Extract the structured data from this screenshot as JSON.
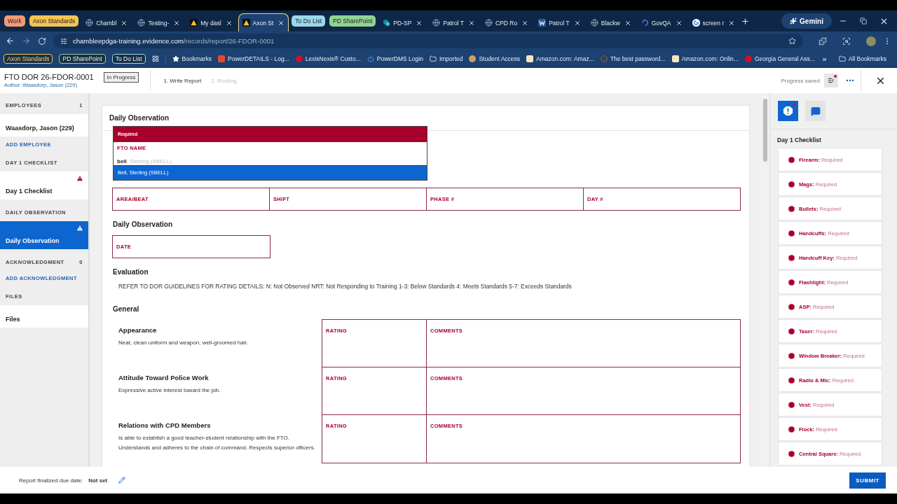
{
  "browser": {
    "tabs": [
      {
        "kind": "group",
        "label": "Work",
        "color": "#f29a76"
      },
      {
        "kind": "group",
        "label": "Axon Standards",
        "color": "#f6c452"
      },
      {
        "kind": "globe",
        "label": "Chambl",
        "selected": false
      },
      {
        "kind": "globe",
        "label": "Testing-",
        "selected": false
      },
      {
        "kind": "axon",
        "label": "My dasl",
        "selected": false
      },
      {
        "kind": "axon",
        "label": "Axon St",
        "selected": true
      },
      {
        "kind": "group",
        "label": "To Do List",
        "color": "#9ad8ea"
      },
      {
        "kind": "group",
        "label": "PD SharePoint",
        "color": "#92d394"
      },
      {
        "kind": "sharepoint",
        "label": "PD-SP",
        "selected": false
      },
      {
        "kind": "globe",
        "label": "Patrol T",
        "selected": false
      },
      {
        "kind": "globe",
        "label": "CPD Ro",
        "selected": false
      },
      {
        "kind": "word",
        "label": "Patrol T",
        "selected": false
      },
      {
        "kind": "globe",
        "label": "Blackw",
        "selected": false
      },
      {
        "kind": "govqa",
        "label": "GovQA",
        "selected": false
      },
      {
        "kind": "google",
        "label": "screen r",
        "selected": false
      }
    ],
    "gemini": "Gemini",
    "address": {
      "host": "chambleepdga-training.evidence.com",
      "path": "/records/report/26-FDOR-0001"
    },
    "bookmark_groups": [
      {
        "label": "Axon Standards",
        "color": "#f6c452"
      },
      {
        "label": "PD SharePoint",
        "color": "#92d394"
      },
      {
        "label": "To Do List",
        "color": "#9ad8ea"
      }
    ],
    "bookmarks": [
      {
        "kind": "star",
        "label": "Bookmarks"
      },
      {
        "kind": "powerdetails",
        "label": "PowerDETAILS - Log..."
      },
      {
        "kind": "lexis",
        "label": "LexisNexis® Custo..."
      },
      {
        "kind": "powerdms",
        "label": "PowerDMS Login"
      },
      {
        "kind": "folder",
        "label": "Imported"
      },
      {
        "kind": "student",
        "label": "Student Access"
      },
      {
        "kind": "amazon",
        "label": "Amazon.com: Amaz..."
      },
      {
        "kind": "info",
        "label": "The best password..."
      },
      {
        "kind": "amazon",
        "label": "Amazon.com: Onlin..."
      },
      {
        "kind": "georgia",
        "label": "Georgia General Ass..."
      }
    ],
    "more": "»",
    "all_bookmarks": "All Bookmarks"
  },
  "header": {
    "title": "FTO DOR 26-FDOR-0001",
    "author": "Author: Waasdorp, Jason (229)",
    "status": "In Progress",
    "steps": [
      {
        "label": "1. Write Report",
        "selected": true
      },
      {
        "label": "2. Routing",
        "selected": false
      }
    ],
    "saved": "Progress saved"
  },
  "sidebar": [
    {
      "heading": "EMPLOYEES",
      "count": "1",
      "items": [
        {
          "label": "Waasdorp, Jason (229)",
          "selected": false,
          "warning": false
        }
      ],
      "link": "ADD EMPLOYEE"
    },
    {
      "heading": "DAY 1 CHECKLIST",
      "items": [
        {
          "label": "Day 1 Checklist",
          "selected": false,
          "warning": true
        }
      ]
    },
    {
      "heading": "DAILY OBSERVATION",
      "items": [
        {
          "label": "Daily Observation",
          "selected": true,
          "warning": true
        }
      ]
    },
    {
      "heading": "ACKNOWLEDGMENT",
      "count": "0",
      "link": "ADD ACKNOWLEDGMENT"
    },
    {
      "heading": "FILES",
      "items": [
        {
          "label": "Files",
          "selected": false,
          "warning": false
        }
      ]
    }
  ],
  "form": {
    "title": "Daily Observation",
    "fto": {
      "banner": "Required",
      "label": "FTO NAME",
      "value": "bell",
      "hint": ", Sterling (SBELL)",
      "options": [
        {
          "label": "Bell, Sterling (SBELL)",
          "selected": true
        }
      ]
    },
    "fields": [
      "AREA/BEAT",
      "SHIFT",
      "PHASE #",
      "DAY #"
    ],
    "sections": [
      {
        "kind": "fields",
        "title": "Daily Observation",
        "fields": [
          "DATE"
        ]
      },
      {
        "kind": "note",
        "title": "Evaluation",
        "text": "REFER TO DOR GUIDELINES FOR RATING DETAILS: N: Not Observed NRT: Not Responding to Training 1-3: Below Standards 4: Meets Standards 5-7: Exceeds Standards"
      },
      {
        "kind": "ratings",
        "title": "General",
        "items": [
          {
            "title": "Appearance",
            "description": "Neat, clean uniform and weapon, well-groomed hair.",
            "rating": "RATING",
            "comments": "COMMENTS"
          },
          {
            "title": "Attitude Toward Police Work",
            "description": "Expressive active interest toward the job.",
            "rating": "RATING",
            "comments": "COMMENTS"
          },
          {
            "title": "Relations with CPD Members",
            "description": "Is able to establish a good teacher-student relationship with the FTO. Understands and adheres to the chain of command. Respects superior officers.",
            "rating": "RATING",
            "comments": "COMMENTS"
          }
        ]
      }
    ]
  },
  "panel": {
    "buttons": [
      {
        "kind": "alert",
        "selected": true
      },
      {
        "kind": "comment",
        "selected": false
      }
    ],
    "title": "Day 1 Checklist",
    "items": [
      {
        "name": "Firearm:",
        "status": "Required"
      },
      {
        "name": "Mags:",
        "status": "Required"
      },
      {
        "name": "Bullets:",
        "status": "Required"
      },
      {
        "name": "Handcuffs:",
        "status": "Required"
      },
      {
        "name": "Handcuff Key:",
        "status": "Required"
      },
      {
        "name": "Flashlight:",
        "status": "Required"
      },
      {
        "name": "ASP:",
        "status": "Required"
      },
      {
        "name": "Taser:",
        "status": "Required"
      },
      {
        "name": "Window Breaker:",
        "status": "Required"
      },
      {
        "name": "Radio & Mic:",
        "status": "Required"
      },
      {
        "name": "Vest:",
        "status": "Required"
      },
      {
        "name": "Flock:",
        "status": "Required"
      },
      {
        "name": "Central Square:",
        "status": "Required"
      }
    ]
  },
  "footer": {
    "label": "Report finalized due date:",
    "value": "Not set",
    "submit": "SUBMIT"
  }
}
